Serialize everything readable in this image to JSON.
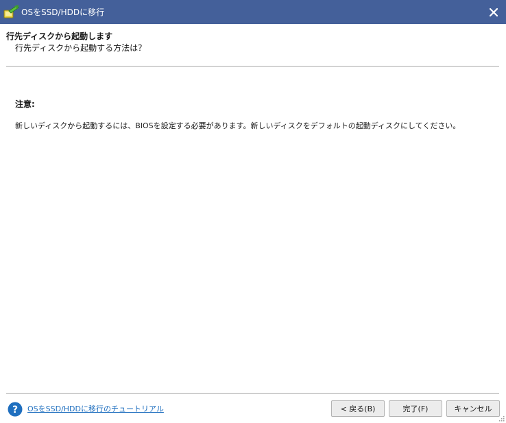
{
  "window": {
    "title": "OSをSSD/HDDに移行",
    "app_icon": "migrate-wizard-icon",
    "close_icon": "close-icon",
    "titlebar_color": "#44609a"
  },
  "header": {
    "title": "行先ディスクから起動します",
    "subtitle": "行先ディスクから起動する方法は？"
  },
  "content": {
    "note_label": "注意:",
    "note_text": "新しいディスクから起動するには、BIOSを設定する必要があります。新しいディスクをデフォルトの起動ディスクにしてください。"
  },
  "footer": {
    "help_icon": "help-icon",
    "tutorial_link": "OSをSSD/HDDに移行のチュートリアル",
    "link_color": "#1f6fbf",
    "buttons": {
      "back": "< 戻る(B)",
      "finish": "完了(F)",
      "cancel": "キャンセル"
    }
  }
}
